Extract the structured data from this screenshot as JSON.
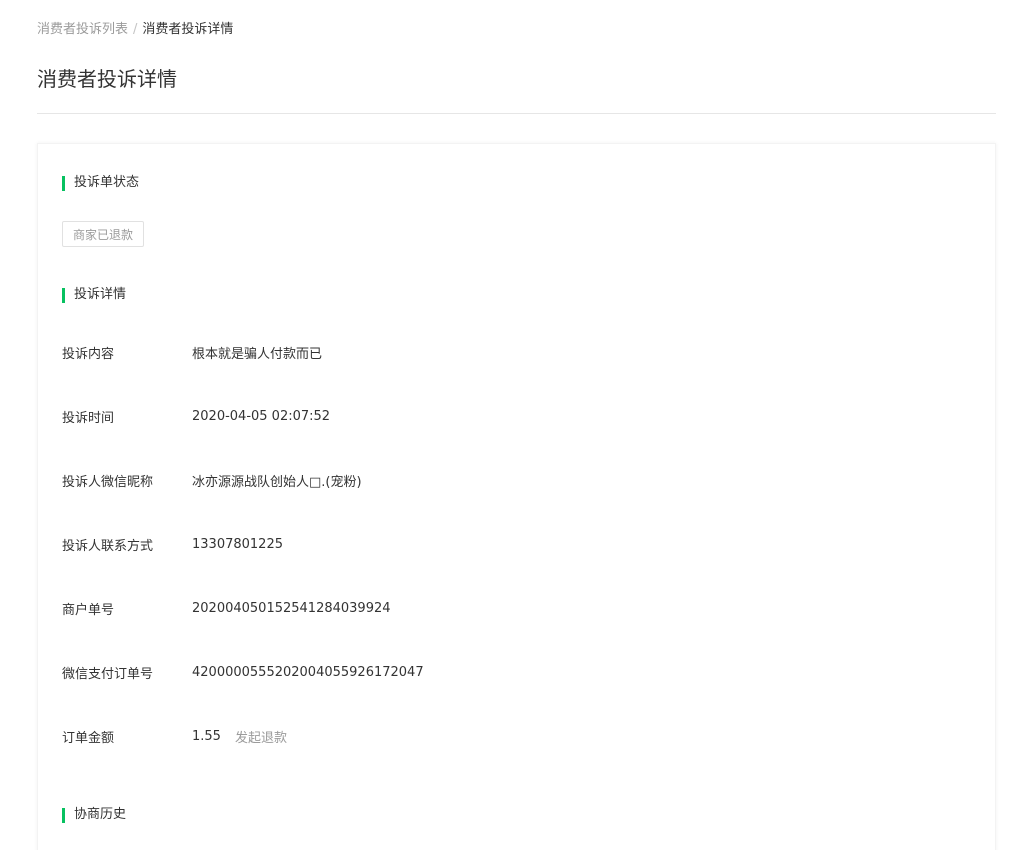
{
  "breadcrumb": {
    "parent": "消费者投诉列表",
    "separator": "/",
    "current": "消费者投诉详情"
  },
  "page_title": "消费者投诉详情",
  "sections": {
    "status": {
      "title": "投诉单状态",
      "tag": "商家已退款"
    },
    "details": {
      "title": "投诉详情",
      "rows": [
        {
          "label": "投诉内容",
          "value": "根本就是骗人付款而已"
        },
        {
          "label": "投诉时间",
          "value": "2020-04-05 02:07:52"
        },
        {
          "label": "投诉人微信昵称",
          "value": "冰亦源源战队创始人□.(宠粉)"
        },
        {
          "label": "投诉人联系方式",
          "value": "13307801225"
        },
        {
          "label": "商户单号",
          "value": "20200405015254128403992​4"
        },
        {
          "label": "微信支付订单号",
          "value": "4200000555202004055926172047"
        },
        {
          "label": "订单金额",
          "value": "1.55",
          "action": "发起退款"
        }
      ]
    },
    "history": {
      "title": "协商历史"
    }
  },
  "colors": {
    "accent": "#07c160",
    "muted_text": "#9b9b9b",
    "divider": "#e6e6e6"
  }
}
